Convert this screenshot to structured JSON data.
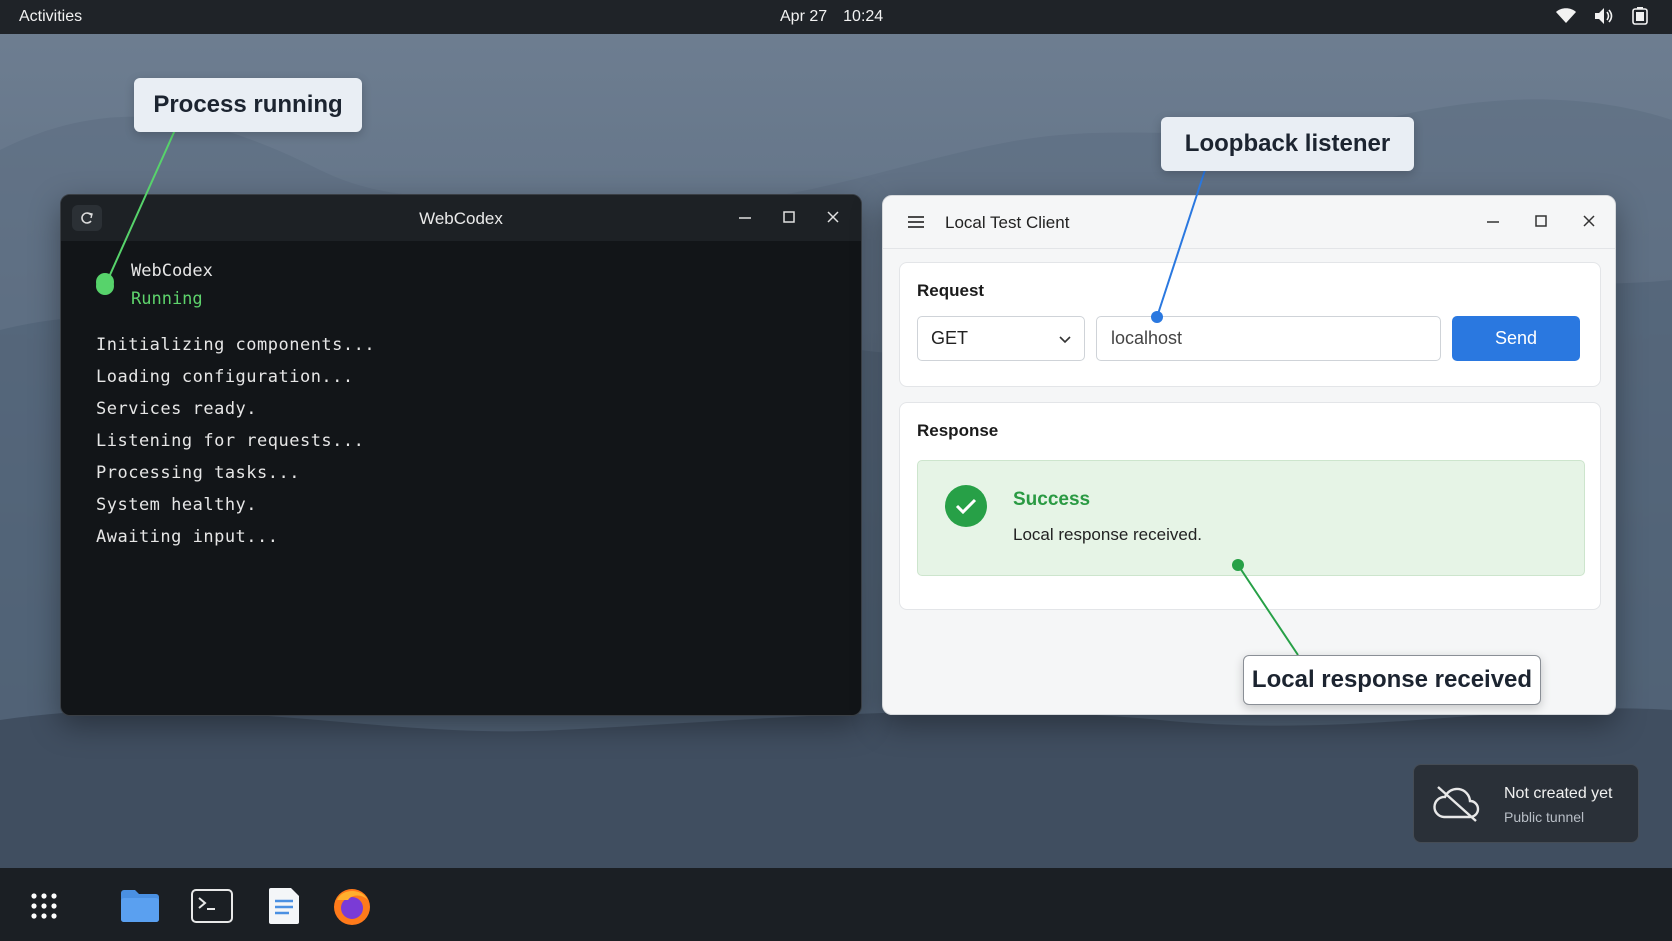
{
  "topbar": {
    "activities": "Activities",
    "date": "Apr 27",
    "time": "10:24",
    "tray_icons": [
      "wifi-icon",
      "volume-icon",
      "battery-icon"
    ]
  },
  "terminal": {
    "title": "WebCodex",
    "process_name": "WebCodex",
    "process_state": "Running",
    "log_lines": [
      "Initializing components...",
      "Loading configuration...",
      "Services ready.",
      "Listening for requests...",
      "Processing tasks...",
      "System healthy.",
      "Awaiting input..."
    ],
    "status_color": "#57d36b"
  },
  "client": {
    "title": "Local Test Client",
    "request": {
      "section_title": "Request",
      "method": "GET",
      "url": "localhost",
      "send_label": "Send"
    },
    "response": {
      "section_title": "Response",
      "status_title": "Success",
      "message": "Local response received."
    },
    "accent_color": "#2a78e0",
    "success_color": "#27a047"
  },
  "callouts": {
    "process": "Process running",
    "loopback": "Loopback listener",
    "local_response": "Local response received"
  },
  "tunnel": {
    "title": "Not created yet",
    "subtitle": "Public tunnel",
    "icon": "cloud-off-icon"
  },
  "dock": {
    "items": [
      "app-grid-icon",
      "files-icon",
      "terminal-icon",
      "text-editor-icon",
      "firefox-icon"
    ]
  }
}
